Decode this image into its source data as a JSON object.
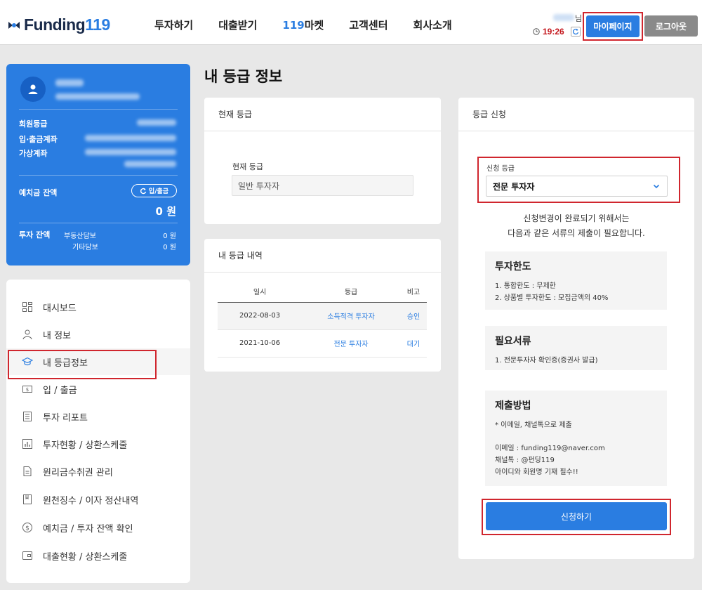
{
  "header": {
    "logo_text": "Funding",
    "logo_num": "119",
    "nav": [
      "투자하기",
      "대출받기",
      "마켓",
      "고객센터",
      "회사소개"
    ],
    "nav_market_prefix": "119",
    "user_suffix": "님",
    "timer": "19:26",
    "mypage_label": "마이페이지",
    "logout_label": "로그아웃"
  },
  "profile": {
    "labels": {
      "grade": "회원등급",
      "account": "입·출금계좌",
      "virtual": "가상계좌",
      "deposit": "예치금 잔액",
      "invest": "투자 잔액"
    },
    "deposit_button": "입/출금",
    "balance": "0 원",
    "invest_rows": [
      {
        "type": "부동산담보",
        "amount": "0 원"
      },
      {
        "type": "기타담보",
        "amount": "0 원"
      }
    ]
  },
  "menu": [
    {
      "label": "대시보드",
      "icon": "dashboard-icon"
    },
    {
      "label": "내 정보",
      "icon": "user-icon"
    },
    {
      "label": "내 등급정보",
      "icon": "graduation-cap-icon"
    },
    {
      "label": "입 / 출금",
      "icon": "money-icon"
    },
    {
      "label": "투자 리포트",
      "icon": "report-icon"
    },
    {
      "label": "투자현황 / 상환스케줄",
      "icon": "bar-chart-icon"
    },
    {
      "label": "원리금수취권 관리",
      "icon": "document-icon"
    },
    {
      "label": "원천징수 / 이자 정산내역",
      "icon": "bookmark-icon"
    },
    {
      "label": "예치금 / 투자 잔액 확인",
      "icon": "dollar-circle-icon"
    },
    {
      "label": "대출현황 / 상환스케줄",
      "icon": "wallet-icon"
    }
  ],
  "page_title": "내 등급 정보",
  "current_grade": {
    "header": "현재 등급",
    "field_label": "현재 등급",
    "value": "일반 투자자"
  },
  "history": {
    "header": "내 등급 내역",
    "columns": [
      "일시",
      "등급",
      "비고"
    ],
    "rows": [
      {
        "date": "2022-08-03",
        "grade": "소득적격 투자자",
        "note": "승인"
      },
      {
        "date": "2021-10-06",
        "grade": "전문 투자자",
        "note": "대기"
      }
    ]
  },
  "apply": {
    "header": "등급 신청",
    "select_label": "신청 등급",
    "selected": "전문 투자자",
    "notice_1": "신청변경이 완료되기 위해서는",
    "notice_2": "다음과 같은 서류의 제출이 필요합니다.",
    "limit_title": "투자한도",
    "limit_lines": [
      "1. 통합한도 : 무제한",
      "2. 상품별 투자한도 : 모집금액의 40%"
    ],
    "docs_title": "필요서류",
    "docs_lines": [
      "1. 전문투자자 확인증(증권사 발급)"
    ],
    "method_title": "제출방법",
    "method_note": "* 이메일, 채널톡으로 제출",
    "method_lines": [
      "이메일 : funding119@naver.com",
      "채널톡 : @펀딩119",
      "아이디와 회원명 기재 필수!!"
    ],
    "submit_label": "신청하기"
  },
  "colors": {
    "accent": "#2a7de1",
    "highlight": "#d0262e",
    "timer": "#c4161c"
  }
}
